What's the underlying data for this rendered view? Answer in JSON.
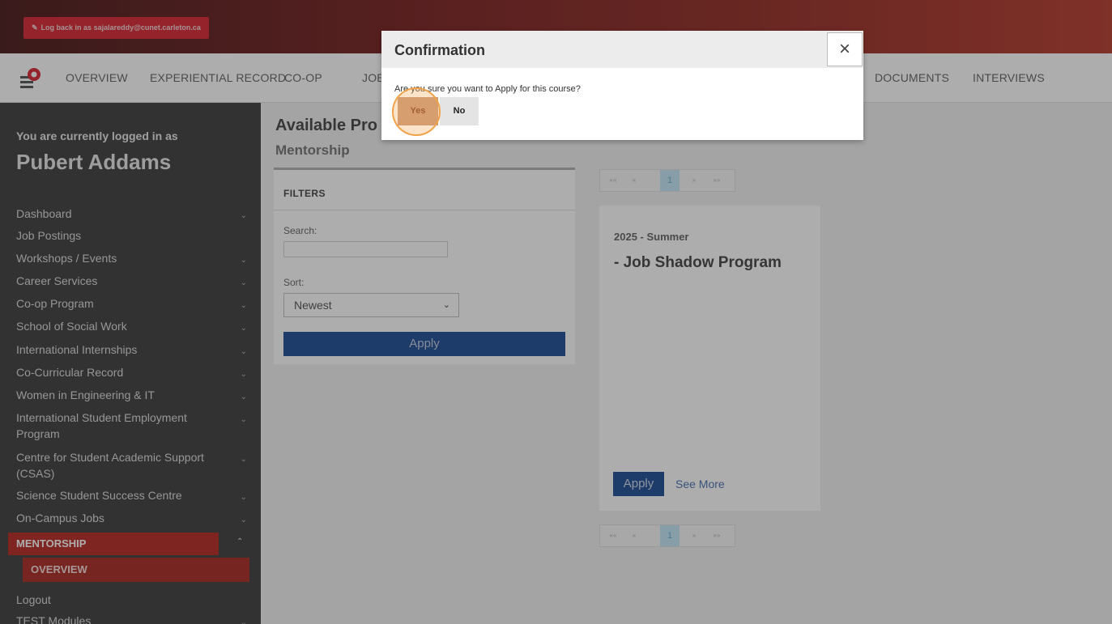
{
  "topbar": {
    "log_back": "Log back in as sajalareddy@cunet.carleton.ca"
  },
  "nav": {
    "items": [
      "OVERVIEW",
      "EXPERIENTIAL RECORD",
      "CO-OP",
      "JOB",
      "DOCUMENTS",
      "INTERVIEWS"
    ]
  },
  "sidebar": {
    "logged_label": "You are currently logged in as",
    "user_name": "Pubert Addams",
    "items": [
      {
        "label": "Dashboard",
        "chevron": true
      },
      {
        "label": "Job Postings",
        "chevron": false
      },
      {
        "label": "Workshops / Events",
        "chevron": true
      },
      {
        "label": "Career Services",
        "chevron": true
      },
      {
        "label": "Co-op Program",
        "chevron": true
      },
      {
        "label": "School of Social Work",
        "chevron": true
      },
      {
        "label": "International Internships",
        "chevron": true
      },
      {
        "label": "Co-Curricular Record",
        "chevron": true
      },
      {
        "label": "Women in Engineering & IT",
        "chevron": true
      },
      {
        "label": "International Student Employment Program",
        "chevron": true
      },
      {
        "label": "Centre for Student Academic Support (CSAS)",
        "chevron": true
      },
      {
        "label": "Science Student Success Centre",
        "chevron": true
      },
      {
        "label": "On-Campus Jobs",
        "chevron": true
      }
    ],
    "mentorship": "MENTORSHIP",
    "overview": "OVERVIEW",
    "logout": "Logout",
    "test_modules": "TEST Modules"
  },
  "main": {
    "title": "Available Pro",
    "subtitle": "Mentorship"
  },
  "filters": {
    "heading": "FILTERS",
    "search_label": "Search:",
    "search_value": "",
    "sort_label": "Sort:",
    "sort_value": "Newest",
    "apply_label": "Apply"
  },
  "pager": {
    "first": "««",
    "prev": "«",
    "page": "1",
    "next": "»",
    "last": "»»"
  },
  "card": {
    "term": "2025 - Summer",
    "title": "- Job Shadow Program",
    "apply_label": "Apply",
    "see_more": "See More"
  },
  "dialog": {
    "title": "Confirmation",
    "close": "×",
    "message": "Are you sure you want to Apply for this course?",
    "yes": "Yes",
    "no": "No"
  },
  "colors": {
    "brand_red": "#b0160e",
    "primary_blue": "#0a3d8c",
    "highlight": "#f0a34a"
  }
}
